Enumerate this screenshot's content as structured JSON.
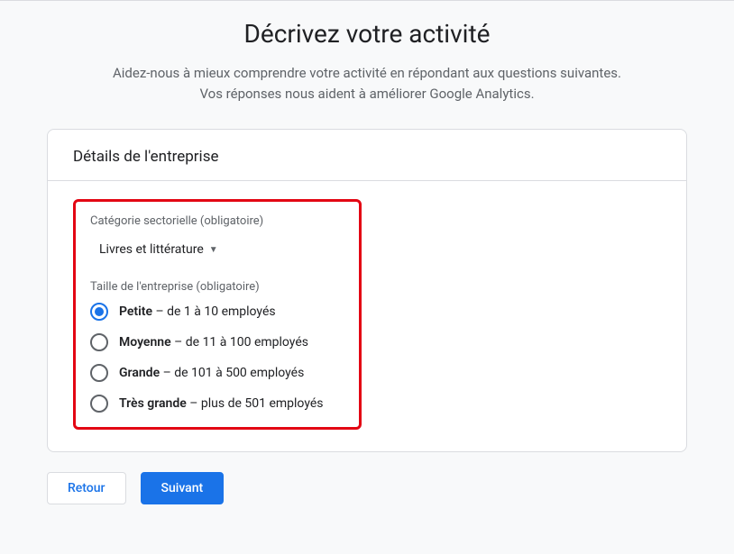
{
  "page": {
    "title": "Décrivez votre activité",
    "subtitle_line1": "Aidez-nous à mieux comprendre votre activité en répondant aux questions suivantes.",
    "subtitle_line2": "Vos réponses nous aident à améliorer Google Analytics."
  },
  "card": {
    "header": "Détails de l'entreprise",
    "category": {
      "label": "Catégorie sectorielle (obligatoire)",
      "selected": "Livres et littérature"
    },
    "size": {
      "label": "Taille de l'entreprise (obligatoire)",
      "options": [
        {
          "strong": "Petite",
          "detail": " – de 1 à 10 employés",
          "selected": true
        },
        {
          "strong": "Moyenne",
          "detail": " – de 11 à 100 employés",
          "selected": false
        },
        {
          "strong": "Grande",
          "detail": " – de 101 à 500 employés",
          "selected": false
        },
        {
          "strong": "Très grande",
          "detail": " – plus de 501 employés",
          "selected": false
        }
      ]
    }
  },
  "buttons": {
    "back": "Retour",
    "next": "Suivant"
  }
}
